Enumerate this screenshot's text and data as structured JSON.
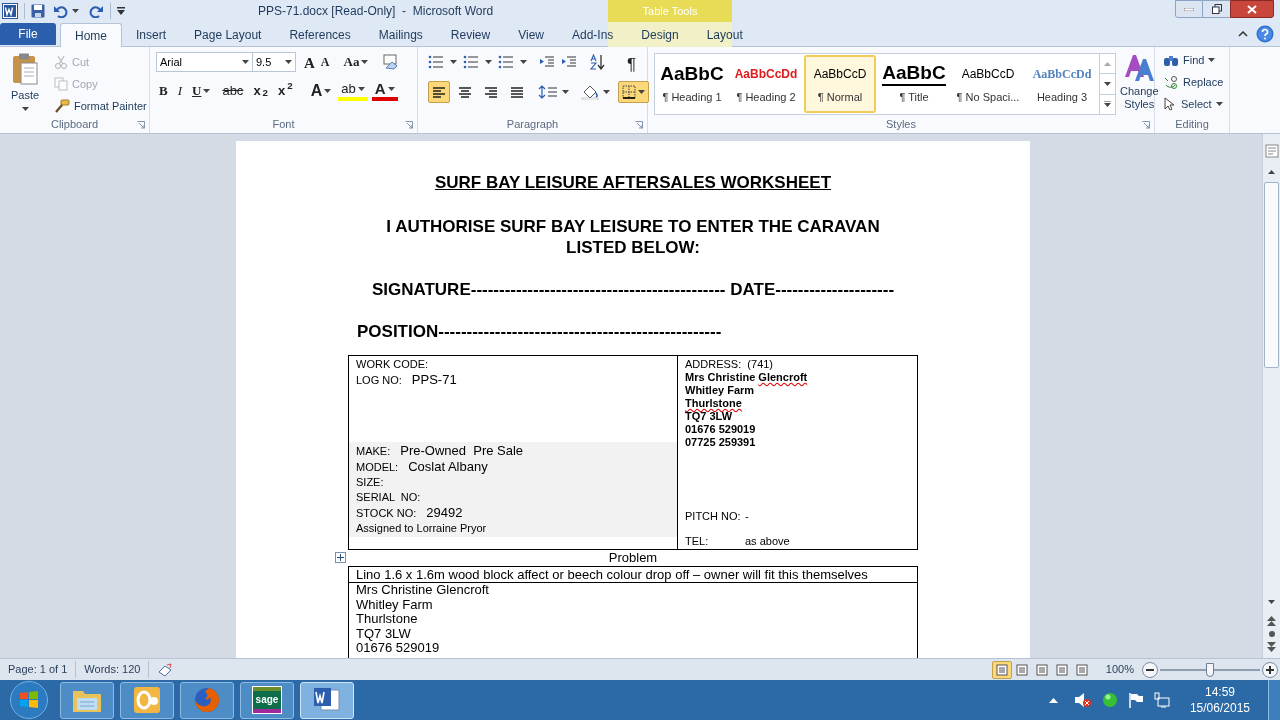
{
  "window": {
    "title": "PPS-71.docx [Read-Only]  -  Microsoft Word",
    "contextual_group": "Table Tools"
  },
  "tabs": [
    {
      "label": "File",
      "kind": "file",
      "selected": false
    },
    {
      "label": "Home",
      "kind": "normal",
      "selected": true
    },
    {
      "label": "Insert",
      "kind": "normal",
      "selected": false
    },
    {
      "label": "Page Layout",
      "kind": "normal",
      "selected": false
    },
    {
      "label": "References",
      "kind": "normal",
      "selected": false
    },
    {
      "label": "Mailings",
      "kind": "normal",
      "selected": false
    },
    {
      "label": "Review",
      "kind": "normal",
      "selected": false
    },
    {
      "label": "View",
      "kind": "normal",
      "selected": false
    },
    {
      "label": "Add-Ins",
      "kind": "normal",
      "selected": false
    },
    {
      "label": "Design",
      "kind": "contextual",
      "selected": false
    },
    {
      "label": "Layout",
      "kind": "contextual",
      "selected": false
    }
  ],
  "clipboard": {
    "paste": "Paste",
    "items": [
      {
        "kind": "cut",
        "label": "Cut",
        "disabled": true
      },
      {
        "kind": "copy",
        "label": "Copy",
        "disabled": true
      },
      {
        "kind": "painter",
        "label": "Format Painter",
        "disabled": false
      }
    ],
    "group_label": "Clipboard"
  },
  "font": {
    "font_name": "Arial",
    "font_size": "9.5",
    "row1_tools": [
      {
        "kind": "grow",
        "label": "A"
      },
      {
        "kind": "shrink",
        "label": "A"
      },
      {
        "kind": "case",
        "label": "Aa"
      }
    ],
    "format_buttons": [
      {
        "kind": "bold",
        "label": "B"
      },
      {
        "kind": "italic",
        "label": "I"
      },
      {
        "kind": "underline",
        "label": "U"
      },
      {
        "kind": "strike",
        "label": "abc"
      },
      {
        "kind": "subscript",
        "label": "x$_{2}$"
      },
      {
        "kind": "superscript",
        "label": "x$^{2}$"
      },
      {
        "kind": "effects",
        "label": "A"
      },
      {
        "kind": "highlight",
        "label": "ab"
      },
      {
        "kind": "color",
        "label": "A"
      }
    ],
    "group_label": "Font"
  },
  "paragraph": {
    "pilcrow": "¶",
    "alignments": [
      {
        "selected": true
      },
      {
        "selected": false
      },
      {
        "selected": false
      },
      {
        "selected": false
      }
    ],
    "borders": {
      "selected": true
    },
    "group_label": "Paragraph"
  },
  "styles": {
    "items": [
      {
        "kind": "heading1",
        "preview": "AaBbC",
        "label": "¶ Heading 1",
        "selected": false
      },
      {
        "kind": "heading2",
        "preview": "AaBbCcDd",
        "label": "¶ Heading 2",
        "selected": false
      },
      {
        "kind": "normal",
        "preview": "AaBbCcD",
        "label": "¶ Normal",
        "selected": true
      },
      {
        "kind": "title",
        "preview": "AaBbC",
        "label": "¶ Title",
        "selected": false
      },
      {
        "kind": "nospacing",
        "preview": "AaBbCcD",
        "label": "¶ No Spaci...",
        "selected": false
      },
      {
        "kind": "heading3",
        "preview": "AaBbCcDd",
        "label": "Heading 3",
        "selected": false
      }
    ],
    "change_styles": "Change Styles",
    "group_label": "Styles"
  },
  "editing": {
    "items": [
      {
        "kind": "find",
        "label": "Find"
      },
      {
        "kind": "replace",
        "label": "Replace"
      },
      {
        "kind": "select",
        "label": "Select"
      }
    ],
    "group_label": "Editing"
  },
  "document": {
    "title": "SURF BAY LEISURE AFTERSALES WORKSHEET",
    "authorisation": "I AUTHORISE SURF BAY LEISURE TO ENTER THE CARAVAN LISTED BELOW:",
    "signature_line": "SIGNATURE--------------------------------------------- DATE---------------------",
    "position_line": "POSITION--------------------------------------------------",
    "left_fields": [
      {
        "label": "WORK CODE:",
        "shaded": false
      },
      {
        "label": "LOG NO:",
        "value": "PPS-71",
        "shaded": false
      },
      {
        "label": "MAKE:",
        "value": "Pre-Owned  Pre Sale",
        "shaded": true
      },
      {
        "label": "MODEL:",
        "value": "Coslat Albany",
        "shaded": true
      },
      {
        "label": "SIZE:",
        "shaded": true
      },
      {
        "label": "SERIAL  NO:",
        "shaded": true
      },
      {
        "label": "STOCK NO:",
        "value": "29492",
        "shaded": true
      }
    ],
    "assigned": "Assigned to Lorraine Pryor",
    "address_label": "ADDRESS:  (741)",
    "address_lines": [
      [
        {
          "text": "Mrs Christine ",
          "misspelled": false
        },
        {
          "text": "Glencroft",
          "misspelled": true
        }
      ],
      [
        {
          "text": "Whitley Farm",
          "misspelled": false
        }
      ],
      [
        {
          "text": "Thurlstone",
          "misspelled": true
        }
      ],
      [
        {
          "text": "TQ7 3LW",
          "misspelled": false
        }
      ],
      [
        {
          "text": "01676 529019",
          "misspelled": false
        }
      ],
      [
        {
          "text": "07725 259391",
          "misspelled": false
        }
      ]
    ],
    "right_fields": [
      {
        "label": "PITCH NO:",
        "value": "-"
      },
      {
        "label": "TEL:",
        "value": "as above"
      }
    ],
    "problem_caption": "Problem",
    "problem_text": "Lino 1.6 x 1.6m wood block affect or beech colour drop off – owner will fit this themselves",
    "contact_lines": [
      "Mrs Christine Glencroft",
      "Whitley Farm",
      "Thurlstone",
      "TQ7 3LW",
      "01676 529019"
    ]
  },
  "status_bar": {
    "page": "Page: 1 of 1",
    "words": "Words: 120",
    "views": [
      {
        "selected": true
      },
      {
        "selected": false
      },
      {
        "selected": false
      },
      {
        "selected": false
      },
      {
        "selected": false
      }
    ],
    "zoom": "100%",
    "zoom_slider": {
      "level": 0.5
    }
  },
  "taskbar": {
    "apps": [
      {
        "kind": "explorer",
        "selected": false
      },
      {
        "kind": "outlook",
        "selected": false
      },
      {
        "kind": "firefox",
        "selected": false
      },
      {
        "kind": "sage",
        "label": "sage",
        "selected": false
      },
      {
        "kind": "word",
        "selected": true
      }
    ],
    "time": "14:59",
    "date": "15/06/2015"
  }
}
